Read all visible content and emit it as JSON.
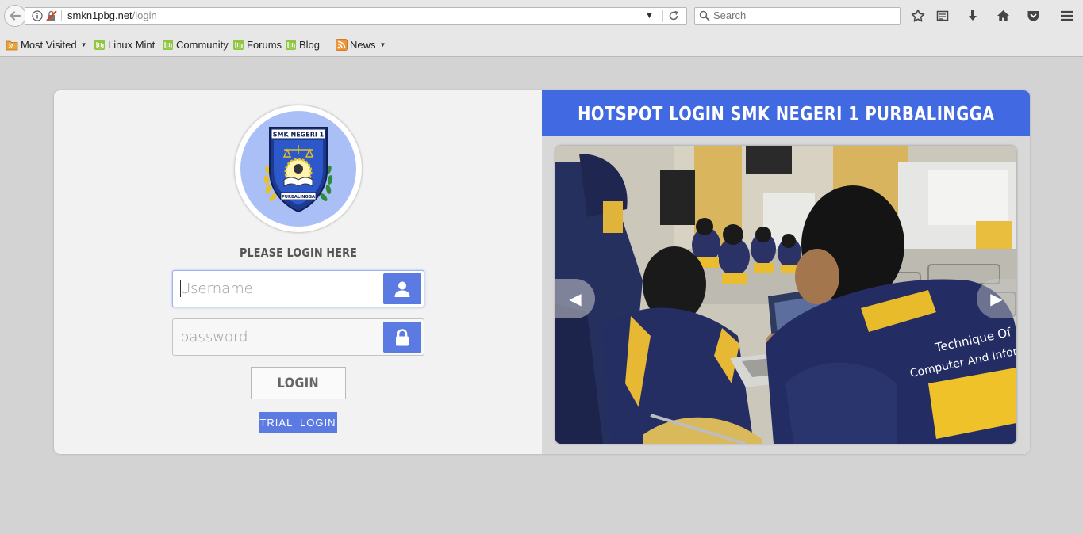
{
  "browser": {
    "url_host": "smkn1pbg.net",
    "url_path": "/login",
    "search_placeholder": "Search",
    "toolbar_icons": [
      "star-icon",
      "reading-list-icon",
      "download-icon",
      "home-icon",
      "pocket-icon",
      "menu-icon"
    ]
  },
  "bookmarks": [
    {
      "label": "Most Visited",
      "icon": "rss-folder-icon",
      "dropdown": true
    },
    {
      "label": "Linux Mint",
      "icon": "mint-icon"
    },
    {
      "label": "Community",
      "icon": "mint-icon"
    },
    {
      "label": "Forums",
      "icon": "mint-icon"
    },
    {
      "label": "Blog",
      "icon": "mint-icon"
    },
    {
      "label": "News",
      "icon": "rss-icon",
      "dropdown": true
    }
  ],
  "login": {
    "heading": "PLEASE LOGIN HERE",
    "username_placeholder": "Username",
    "password_placeholder": "password",
    "login_label": "LOGIN",
    "trial_label": "TRIAL  LOGIN",
    "logo_text_top": "SMK NEGERI 1",
    "logo_text_bottom": "PURBALINGGA"
  },
  "banner": {
    "title": "HOTSPOT LOGIN SMK NEGERI 1 PURBALINGGA"
  },
  "slider": {
    "prev_glyph": "◀",
    "next_glyph": "▶",
    "shirt_text_line1": "Technique Of",
    "shirt_text_line2": "Computer And Informatics"
  },
  "colors": {
    "accent": "#4169e1",
    "button": "#5b7be3",
    "page_bg": "#d3d3d3"
  }
}
